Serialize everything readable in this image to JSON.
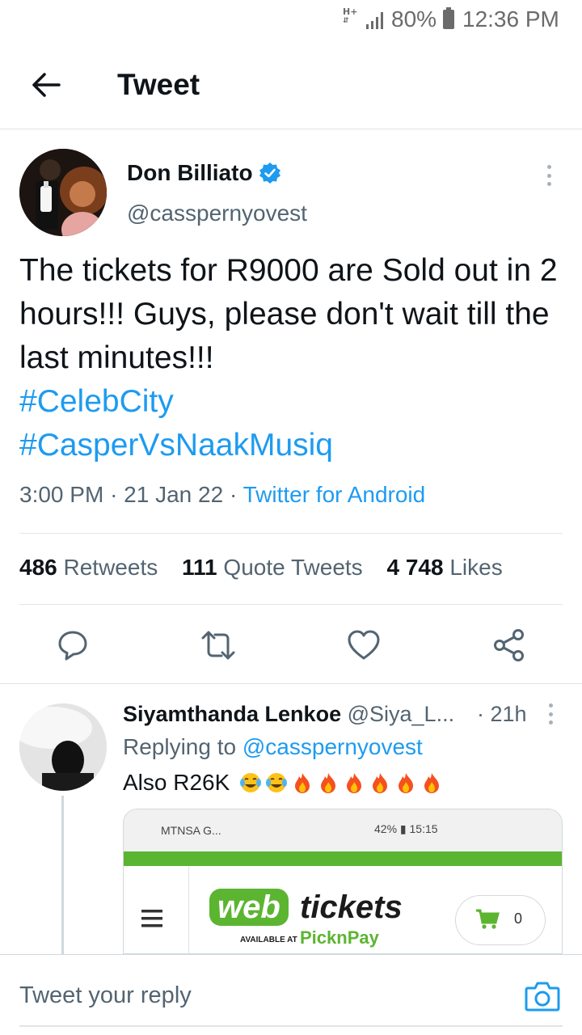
{
  "status_bar": {
    "network": "H+",
    "battery": "80%",
    "time": "12:36 PM"
  },
  "header": {
    "title": "Tweet"
  },
  "tweet": {
    "author_name": "Don Billiato",
    "author_handle": "@casspernyovest",
    "text": "The tickets for R9000 are Sold out in 2 hours!!! Guys, please don't wait till the last minutes!!!",
    "hashtags": [
      "#CelebCity",
      "#CasperVsNaakMusiq"
    ],
    "time": "3:00 PM",
    "date": "21 Jan 22",
    "source": "Twitter for Android",
    "retweets_count": "486",
    "retweets_label": "Retweets",
    "quotes_count": "111",
    "quotes_label": "Quote Tweets",
    "likes_count": "4 748",
    "likes_label": "Likes"
  },
  "reply": {
    "name": "Siyamthanda Lenkoe",
    "handle": "@Siya_L...",
    "time": "21h",
    "replying_prefix": "Replying to",
    "replying_to": "@casspernyovest",
    "text": "Also R26K",
    "emojis": [
      "joy",
      "joy",
      "fire",
      "fire",
      "fire",
      "fire",
      "fire",
      "fire"
    ]
  },
  "media": {
    "carrier": "MTNSA G...",
    "status_right": "42%",
    "clock": "15:15",
    "logo_web": "web",
    "logo_tickets": "tickets",
    "available_at": "AVAILABLE AT",
    "partner": "PicknPay",
    "cart_count": "0"
  },
  "reply_bar": {
    "placeholder": "Tweet your reply"
  },
  "colors": {
    "accent": "#1d9bf0",
    "text_primary": "#0f1419",
    "text_secondary": "#536471",
    "divider": "#e1e5e8",
    "webtickets_green": "#5cb531"
  },
  "icons": {
    "back": "arrow-left-icon",
    "verified": "verified-badge-icon",
    "more": "vertical-dots-icon",
    "reply": "comment-bubble-icon",
    "retweet": "retweet-icon",
    "like": "heart-icon",
    "share": "share-icon",
    "camera": "camera-icon"
  }
}
